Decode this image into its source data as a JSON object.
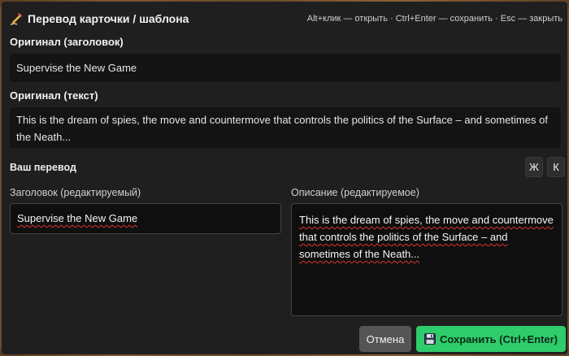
{
  "dialog": {
    "title": "Перевод карточки / шаблона",
    "hint": "Alt+клик — открыть · Ctrl+Enter — сохранить · Esc — закрыть"
  },
  "original": {
    "title_label": "Оригинал (заголовок)",
    "title_value": "Supervise the New Game",
    "text_label": "Оригинал (текст)",
    "text_value": "This is the dream of spies, the move and countermove that controls the politics of the Surface – and sometimes of the Neath..."
  },
  "translation": {
    "label": "Ваш перевод",
    "bold_button": "Ж",
    "italic_button": "К",
    "title_field_label": "Заголовок (редактируемый)",
    "title_field_value": "Supervise the New Game",
    "desc_field_label": "Описание (редактируемое)",
    "desc_field_value": "This is the dream of spies, the move and countermove that controls the politics of the Surface – and sometimes of the Neath..."
  },
  "actions": {
    "cancel_label": "Отмена",
    "save_label": "Сохранить (Ctrl+Enter)"
  },
  "colors": {
    "dialog_bg": "#1f1f1f",
    "save_button": "#2ecc6b",
    "cancel_button": "#555555",
    "spellcheck_underline": "#dd3333"
  },
  "icons": {
    "title": "pencil-writing-icon",
    "save": "floppy-disk-icon"
  }
}
